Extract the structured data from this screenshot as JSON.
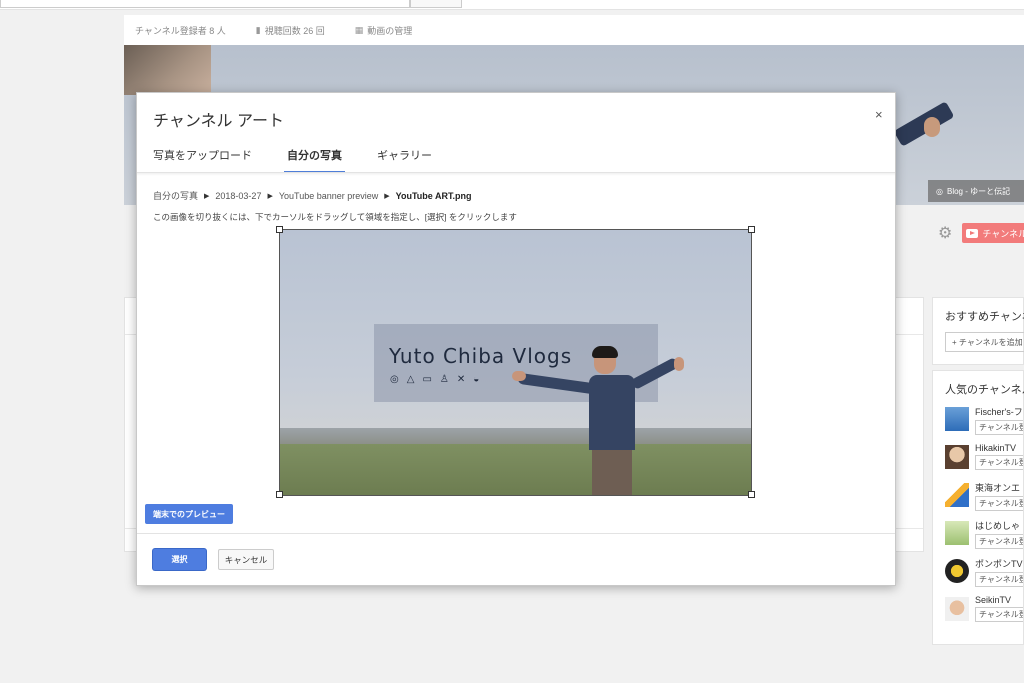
{
  "stats": {
    "subscribers": "チャンネル登録者 8 人",
    "views": "視聴回数 26 回",
    "manage_videos": "動画の管理"
  },
  "banner": {
    "blog_link": "Blog - ゆーと伝記"
  },
  "channel": {
    "subscribe_label": "チャンネル"
  },
  "sidebar": {
    "recommended_title": "おすすめチャンネル",
    "add_channel": "+ チャンネルを追加",
    "popular_title": "人気のチャンネル",
    "channels": [
      {
        "name": "Fischer's-フ",
        "sub": "チャンネル登"
      },
      {
        "name": "HikakinTV",
        "sub": "チャンネル登"
      },
      {
        "name": "東海オンエ",
        "sub": "チャンネル登"
      },
      {
        "name": "はじめしゃ",
        "sub": "チャンネル登"
      },
      {
        "name": "ポンポンTV",
        "sub": "チャンネル登"
      },
      {
        "name": "SeikinTV",
        "sub": "チャンネル登"
      }
    ]
  },
  "modal": {
    "title": "チャンネル アート",
    "close": "×",
    "tabs": [
      {
        "label": "写真をアップロード"
      },
      {
        "label": "自分の写真"
      },
      {
        "label": "ギャラリー"
      }
    ],
    "breadcrumb": [
      "自分の写真",
      "2018-03-27",
      "YouTube banner preview",
      "YouTube ART.png"
    ],
    "breadcrumb_sep": "▶",
    "instruction": "この画像を切り抜くには、下でカーソルをドラッグして領域を指定し、[選択] をクリックします",
    "image_overlay_title": "Yuto Chiba Vlogs",
    "image_overlay_icons": [
      "bicycle-icon",
      "tent-icon",
      "laptop-icon",
      "hiker-icon",
      "tools-icon",
      "food-icon"
    ],
    "preview_button": "端末でのプレビュー",
    "select_button": "選択",
    "cancel_button": "キャンセル"
  },
  "colors": {
    "accent": "#4e7de0",
    "subscribe": "#f27b7b"
  }
}
